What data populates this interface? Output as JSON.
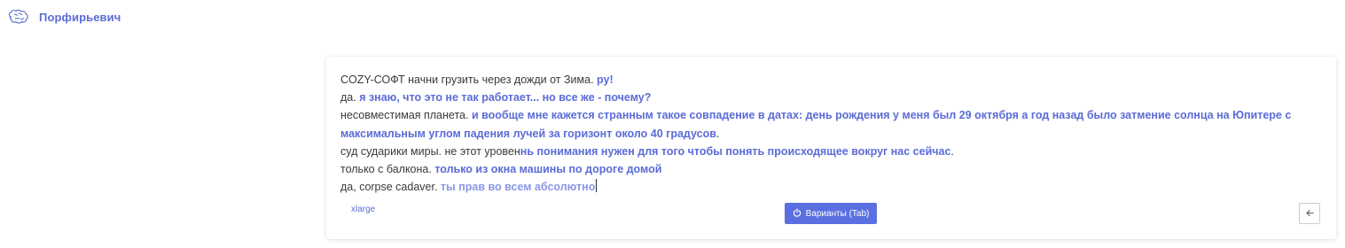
{
  "app": {
    "brand": "Порфирьевич",
    "logo_icon": "brain-icon",
    "accent_color": "#5b6bd6",
    "button_color": "#5a6fe0"
  },
  "editor": {
    "lines": [
      {
        "prompt": "COZY-СОФТ начни грузить через дожди от Зима. ",
        "generated": "ру!"
      },
      {
        "prompt": "да. ",
        "generated": "я знаю, что это не так работает... но все же - почему?"
      },
      {
        "prompt": "несовместимая планета. ",
        "generated": "и вообще мне кажется странным такое совпадение в датах: день рождения у меня был 29 октября а год назад было затмение солнца на Юпитере с максимальным углом падения лучей за горизонт около 40 градусов",
        "suffix": "."
      },
      {
        "prompt": "суд сударики миры. не этот уровен",
        "generated": "нь понимания нужен для того чтобы понять происходящее вокруг нас сейчас",
        "suffix": "."
      },
      {
        "prompt": "только с балкона. ",
        "generated": "только из окна машины по дороге домой"
      },
      {
        "prompt": "да, corpse cadaver. ",
        "generated": "ты прав во всем абсолютно"
      }
    ]
  },
  "controls": {
    "model": "xlarge",
    "variants_label": "Варианты (Tab)",
    "variants_icon": "power-icon",
    "back_icon": "arrow-left-icon"
  }
}
